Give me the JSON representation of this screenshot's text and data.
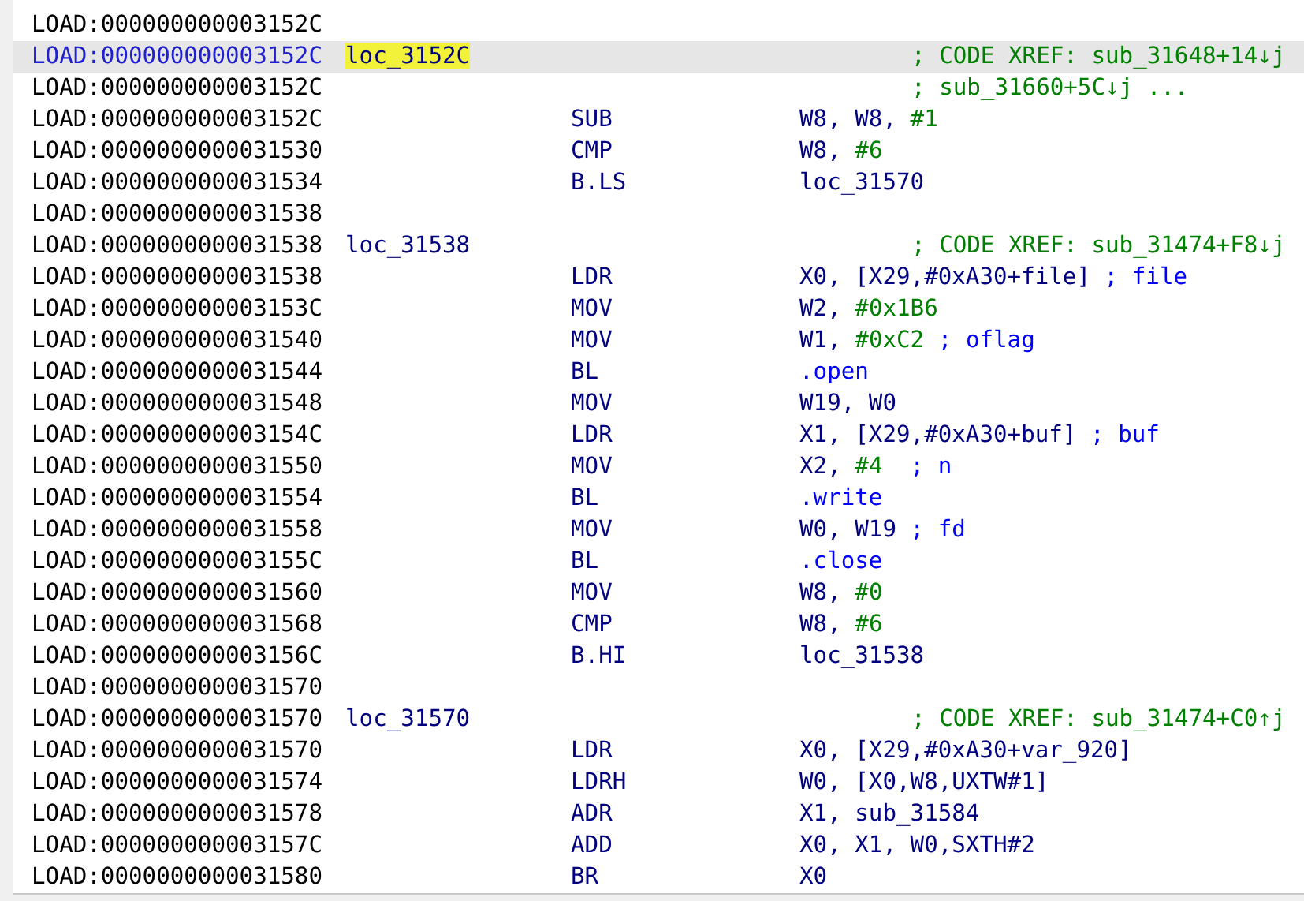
{
  "listing": [
    {
      "address": "LOAD:000000000003152C",
      "selected": false
    },
    {
      "address": "LOAD:000000000003152C",
      "selected": true,
      "label": {
        "text": "loc_3152C",
        "highlighted": true
      },
      "xref": "; CODE XREF: sub_31648+14↓j"
    },
    {
      "address": "LOAD:000000000003152C",
      "selected": false,
      "xref": "; sub_31660+5C↓j ..."
    },
    {
      "address": "LOAD:000000000003152C",
      "selected": false,
      "mnemonic": "SUB",
      "operands": [
        {
          "text": "W8, W8, ",
          "kind": "op"
        },
        {
          "text": "#1",
          "kind": "num"
        }
      ]
    },
    {
      "address": "LOAD:0000000000031530",
      "selected": false,
      "mnemonic": "CMP",
      "operands": [
        {
          "text": "W8, ",
          "kind": "op"
        },
        {
          "text": "#6",
          "kind": "num"
        }
      ]
    },
    {
      "address": "LOAD:0000000000031534",
      "selected": false,
      "mnemonic": "B.LS",
      "operands": [
        {
          "text": "loc_31570",
          "kind": "op"
        }
      ]
    },
    {
      "address": "LOAD:0000000000031538",
      "selected": false
    },
    {
      "address": "LOAD:0000000000031538",
      "selected": false,
      "label": {
        "text": "loc_31538",
        "highlighted": false
      },
      "xref": "; CODE XREF: sub_31474+F8↓j"
    },
    {
      "address": "LOAD:0000000000031538",
      "selected": false,
      "mnemonic": "LDR",
      "operands": [
        {
          "text": "X0, [X29,#0xA30+file]",
          "kind": "op"
        },
        {
          "text": " ; file",
          "kind": "comment"
        }
      ]
    },
    {
      "address": "LOAD:000000000003153C",
      "selected": false,
      "mnemonic": "MOV",
      "operands": [
        {
          "text": "W2, ",
          "kind": "op"
        },
        {
          "text": "#0x1B6",
          "kind": "num"
        }
      ]
    },
    {
      "address": "LOAD:0000000000031540",
      "selected": false,
      "mnemonic": "MOV",
      "operands": [
        {
          "text": "W1, ",
          "kind": "op"
        },
        {
          "text": "#0xC2",
          "kind": "num"
        },
        {
          "text": " ; oflag",
          "kind": "comment"
        }
      ]
    },
    {
      "address": "LOAD:0000000000031544",
      "selected": false,
      "mnemonic": "BL",
      "operands": [
        {
          "text": ".open",
          "kind": "import"
        }
      ]
    },
    {
      "address": "LOAD:0000000000031548",
      "selected": false,
      "mnemonic": "MOV",
      "operands": [
        {
          "text": "W19, W0",
          "kind": "op"
        }
      ]
    },
    {
      "address": "LOAD:000000000003154C",
      "selected": false,
      "mnemonic": "LDR",
      "operands": [
        {
          "text": "X1, [X29,#0xA30+buf]",
          "kind": "op"
        },
        {
          "text": " ; buf",
          "kind": "comment"
        }
      ]
    },
    {
      "address": "LOAD:0000000000031550",
      "selected": false,
      "mnemonic": "MOV",
      "operands": [
        {
          "text": "X2, ",
          "kind": "op"
        },
        {
          "text": "#4",
          "kind": "num"
        },
        {
          "text": "  ; n",
          "kind": "comment"
        }
      ]
    },
    {
      "address": "LOAD:0000000000031554",
      "selected": false,
      "mnemonic": "BL",
      "operands": [
        {
          "text": ".write",
          "kind": "import"
        }
      ]
    },
    {
      "address": "LOAD:0000000000031558",
      "selected": false,
      "mnemonic": "MOV",
      "operands": [
        {
          "text": "W0, W19",
          "kind": "op"
        },
        {
          "text": " ; fd",
          "kind": "comment"
        }
      ]
    },
    {
      "address": "LOAD:000000000003155C",
      "selected": false,
      "mnemonic": "BL",
      "operands": [
        {
          "text": ".close",
          "kind": "import"
        }
      ]
    },
    {
      "address": "LOAD:0000000000031560",
      "selected": false,
      "mnemonic": "MOV",
      "operands": [
        {
          "text": "W8, ",
          "kind": "op"
        },
        {
          "text": "#0",
          "kind": "num"
        }
      ]
    },
    {
      "address": "LOAD:0000000000031568",
      "selected": false,
      "mnemonic": "CMP",
      "operands": [
        {
          "text": "W8, ",
          "kind": "op"
        },
        {
          "text": "#6",
          "kind": "num"
        }
      ]
    },
    {
      "address": "LOAD:000000000003156C",
      "selected": false,
      "mnemonic": "B.HI",
      "operands": [
        {
          "text": "loc_31538",
          "kind": "op"
        }
      ]
    },
    {
      "address": "LOAD:0000000000031570",
      "selected": false
    },
    {
      "address": "LOAD:0000000000031570",
      "selected": false,
      "label": {
        "text": "loc_31570",
        "highlighted": false
      },
      "xref": "; CODE XREF: sub_31474+C0↑j"
    },
    {
      "address": "LOAD:0000000000031570",
      "selected": false,
      "mnemonic": "LDR",
      "operands": [
        {
          "text": "X0, [X29,#0xA30+var_920]",
          "kind": "op"
        }
      ]
    },
    {
      "address": "LOAD:0000000000031574",
      "selected": false,
      "mnemonic": "LDRH",
      "operands": [
        {
          "text": "W0, [X0,W8,UXTW#1]",
          "kind": "op"
        }
      ]
    },
    {
      "address": "LOAD:0000000000031578",
      "selected": false,
      "mnemonic": "ADR",
      "operands": [
        {
          "text": "X1, sub_31584",
          "kind": "op"
        }
      ]
    },
    {
      "address": "LOAD:000000000003157C",
      "selected": false,
      "mnemonic": "ADD",
      "operands": [
        {
          "text": "X0, X1, W0,SXTH#2",
          "kind": "op"
        }
      ]
    },
    {
      "address": "LOAD:0000000000031580",
      "selected": false,
      "mnemonic": "BR",
      "operands": [
        {
          "text": "X0",
          "kind": "op"
        }
      ]
    }
  ]
}
